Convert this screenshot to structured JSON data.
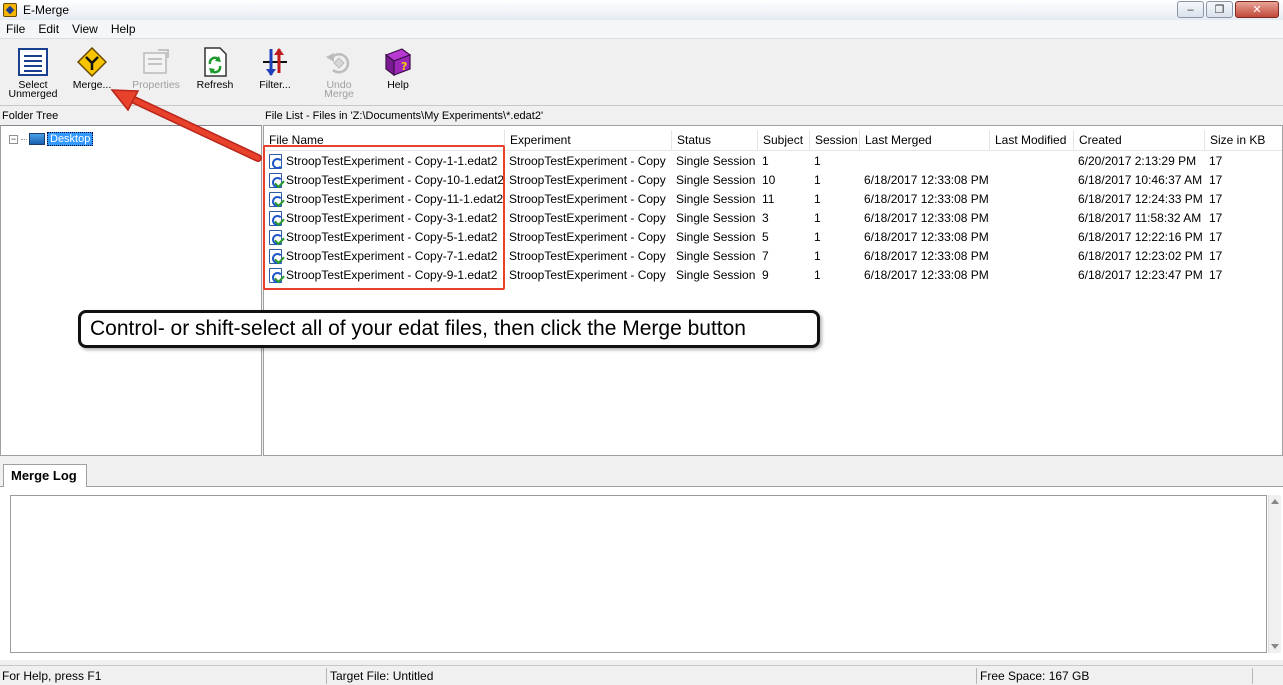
{
  "window": {
    "title": "E-Merge"
  },
  "menu": [
    "File",
    "Edit",
    "View",
    "Help"
  ],
  "toolbar": {
    "select_unmerged": {
      "line1": "Select",
      "line2": "Unmerged"
    },
    "merge": "Merge...",
    "properties": "Properties",
    "refresh": "Refresh",
    "filter": "Filter...",
    "undo_merge": {
      "line1": "Undo",
      "line2": "Merge"
    },
    "help": "Help"
  },
  "folder_tree": {
    "header": "Folder Tree",
    "root_label": "Desktop",
    "expander": "−"
  },
  "file_list": {
    "header": "File List - Files in 'Z:\\Documents\\My Experiments\\*.edat2'",
    "columns": [
      "File Name",
      "Experiment",
      "Status",
      "Subject",
      "Session",
      "Last Merged",
      "Last Modified",
      "Created",
      "Size in KB"
    ],
    "rows": [
      {
        "name": "StroopTestExperiment - Copy-1-1.edat2",
        "experiment": "StroopTestExperiment - Copy",
        "status": "Single Session",
        "subject": "1",
        "session": "1",
        "last_merged": "",
        "last_modified": "",
        "created": "6/20/2017 2:13:29 PM",
        "size": "17",
        "merged": false
      },
      {
        "name": "StroopTestExperiment - Copy-10-1.edat2",
        "experiment": "StroopTestExperiment - Copy",
        "status": "Single Session",
        "subject": "10",
        "session": "1",
        "last_merged": "6/18/2017 12:33:08 PM",
        "last_modified": "",
        "created": "6/18/2017 10:46:37 AM",
        "size": "17",
        "merged": true
      },
      {
        "name": "StroopTestExperiment - Copy-11-1.edat2",
        "experiment": "StroopTestExperiment - Copy",
        "status": "Single Session",
        "subject": "11",
        "session": "1",
        "last_merged": "6/18/2017 12:33:08 PM",
        "last_modified": "",
        "created": "6/18/2017 12:24:33 PM",
        "size": "17",
        "merged": true
      },
      {
        "name": "StroopTestExperiment - Copy-3-1.edat2",
        "experiment": "StroopTestExperiment - Copy",
        "status": "Single Session",
        "subject": "3",
        "session": "1",
        "last_merged": "6/18/2017 12:33:08 PM",
        "last_modified": "",
        "created": "6/18/2017 11:58:32 AM",
        "size": "17",
        "merged": true
      },
      {
        "name": "StroopTestExperiment - Copy-5-1.edat2",
        "experiment": "StroopTestExperiment - Copy",
        "status": "Single Session",
        "subject": "5",
        "session": "1",
        "last_merged": "6/18/2017 12:33:08 PM",
        "last_modified": "",
        "created": "6/18/2017 12:22:16 PM",
        "size": "17",
        "merged": true
      },
      {
        "name": "StroopTestExperiment - Copy-7-1.edat2",
        "experiment": "StroopTestExperiment - Copy",
        "status": "Single Session",
        "subject": "7",
        "session": "1",
        "last_merged": "6/18/2017 12:33:08 PM",
        "last_modified": "",
        "created": "6/18/2017 12:23:02 PM",
        "size": "17",
        "merged": true
      },
      {
        "name": "StroopTestExperiment - Copy-9-1.edat2",
        "experiment": "StroopTestExperiment - Copy",
        "status": "Single Session",
        "subject": "9",
        "session": "1",
        "last_merged": "6/18/2017 12:33:08 PM",
        "last_modified": "",
        "created": "6/18/2017 12:23:47 PM",
        "size": "17",
        "merged": true
      }
    ]
  },
  "callout": {
    "text": "Control- or shift-select all of your edat files, then click the Merge button"
  },
  "annotation_color": "#e8412c",
  "merge_log": {
    "tab_label": "Merge Log"
  },
  "status_bar": {
    "help": "For Help, press F1",
    "target": "Target File: Untitled",
    "free_space": "Free Space: 167 GB"
  },
  "icons": {
    "app": "emerge-app-icon",
    "select_unmerged": "select-list-icon",
    "merge": "merge-diamond-icon",
    "properties": "properties-icon",
    "refresh": "refresh-icon",
    "filter": "filter-icon",
    "undo_merge": "undo-merge-icon",
    "help": "help-book-icon",
    "file": "edat-file-icon"
  }
}
